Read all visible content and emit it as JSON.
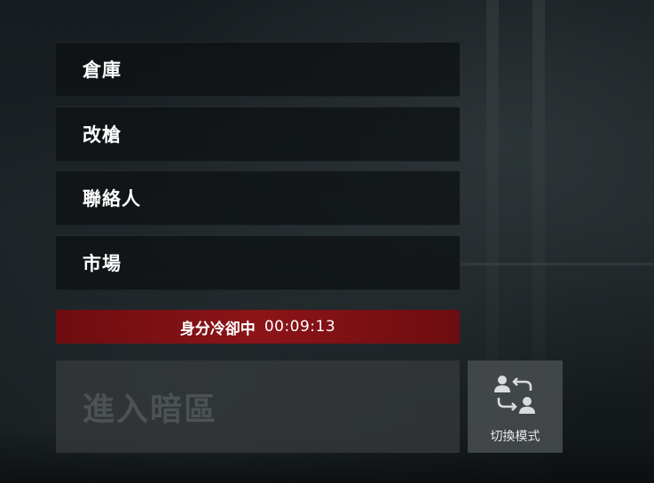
{
  "menu": {
    "items": [
      {
        "label": "倉庫"
      },
      {
        "label": "改槍"
      },
      {
        "label": "聯絡人"
      },
      {
        "label": "市場"
      }
    ]
  },
  "cooldown": {
    "label": "身分冷卻中",
    "timer": "00:09:13",
    "color": "#8c1418"
  },
  "enter_button": {
    "label": "進入暗區"
  },
  "switch_button": {
    "label": "切換模式",
    "icon": "switch-user-icon"
  }
}
